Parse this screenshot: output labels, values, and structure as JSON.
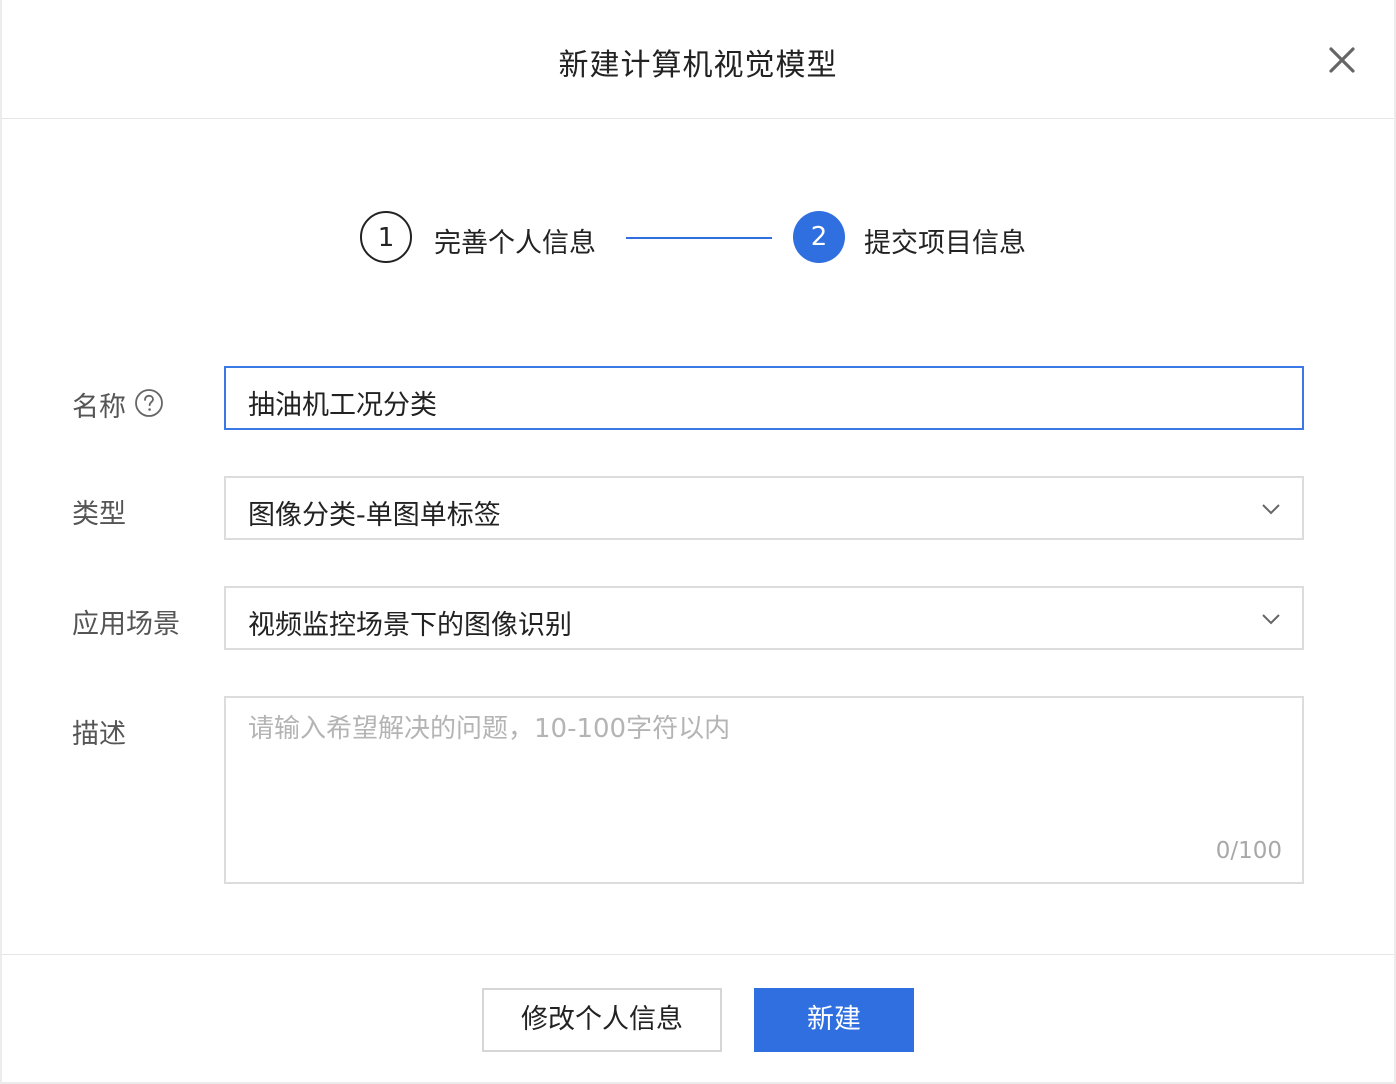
{
  "dialog": {
    "title": "新建计算机视觉模型"
  },
  "steps": [
    {
      "number": "1",
      "label": "完善个人信息"
    },
    {
      "number": "2",
      "label": "提交项目信息"
    }
  ],
  "form": {
    "name": {
      "label": "名称",
      "value": "抽油机工况分类"
    },
    "type": {
      "label": "类型",
      "value": "图像分类-单图单标签"
    },
    "scene": {
      "label": "应用场景",
      "value": "视频监控场景下的图像识别"
    },
    "description": {
      "label": "描述",
      "placeholder": "请输入希望解决的问题，10-100字符以内",
      "counter": "0/100"
    }
  },
  "footer": {
    "secondary_label": "修改个人信息",
    "primary_label": "新建"
  },
  "colors": {
    "primary": "#2f6fe0",
    "input_focus_border": "#3a78e6"
  }
}
